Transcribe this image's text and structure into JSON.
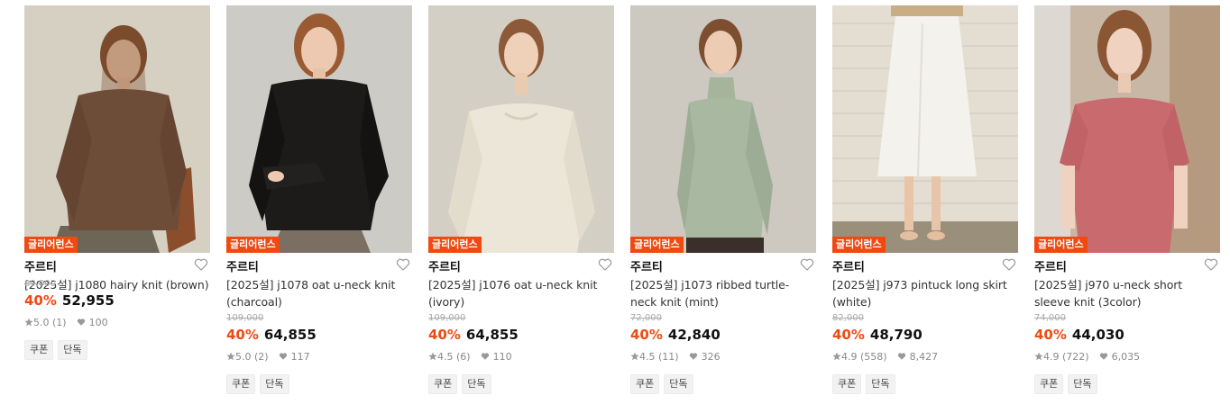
{
  "colors": {
    "accent": "#f04a12",
    "badge_bg": "#f04a12"
  },
  "products": [
    {
      "badge": "글리어런스",
      "brand": "주르티",
      "title_line1": "[2025설] j1080 hairy knit (brown)",
      "title_line2": "",
      "original_price": "89,000",
      "discount": "40%",
      "price": "52,955",
      "rating": "5.0 (1)",
      "likes": "100",
      "tags": [
        "쿠폰",
        "단독"
      ]
    },
    {
      "badge": "글리어런스",
      "brand": "주르티",
      "title_line1": "[2025설] j1078 oat u-neck knit",
      "title_line2": "(charcoal)",
      "original_price": "109,000",
      "discount": "40%",
      "price": "64,855",
      "rating": "5.0 (2)",
      "likes": "117",
      "tags": [
        "쿠폰",
        "단독"
      ]
    },
    {
      "badge": "글리어런스",
      "brand": "주르티",
      "title_line1": "[2025설] j1076 oat u-neck knit",
      "title_line2": "(ivory)",
      "original_price": "109,000",
      "discount": "40%",
      "price": "64,855",
      "rating": "4.5 (6)",
      "likes": "110",
      "tags": [
        "쿠폰",
        "단독"
      ]
    },
    {
      "badge": "글리어런스",
      "brand": "주르티",
      "title_line1": "[2025설] j1073 ribbed turtle-",
      "title_line2": "neck knit (mint)",
      "original_price": "72,000",
      "discount": "40%",
      "price": "42,840",
      "rating": "4.5 (11)",
      "likes": "326",
      "tags": [
        "쿠폰",
        "단독"
      ]
    },
    {
      "badge": "글리어런스",
      "brand": "주르티",
      "title_line1": "[2025설] j973 pintuck long skirt",
      "title_line2": "(white)",
      "original_price": "82,000",
      "discount": "40%",
      "price": "48,790",
      "rating": "4.9 (558)",
      "likes": "8,427",
      "tags": [
        "쿠폰",
        "단독"
      ]
    },
    {
      "badge": "글리어런스",
      "brand": "주르티",
      "title_line1": "[2025설] j970 u-neck short",
      "title_line2": "sleeve knit (3color)",
      "original_price": "74,000",
      "discount": "40%",
      "price": "44,030",
      "rating": "4.9 (722)",
      "likes": "6,035",
      "tags": [
        "쿠폰",
        "단독"
      ]
    }
  ]
}
